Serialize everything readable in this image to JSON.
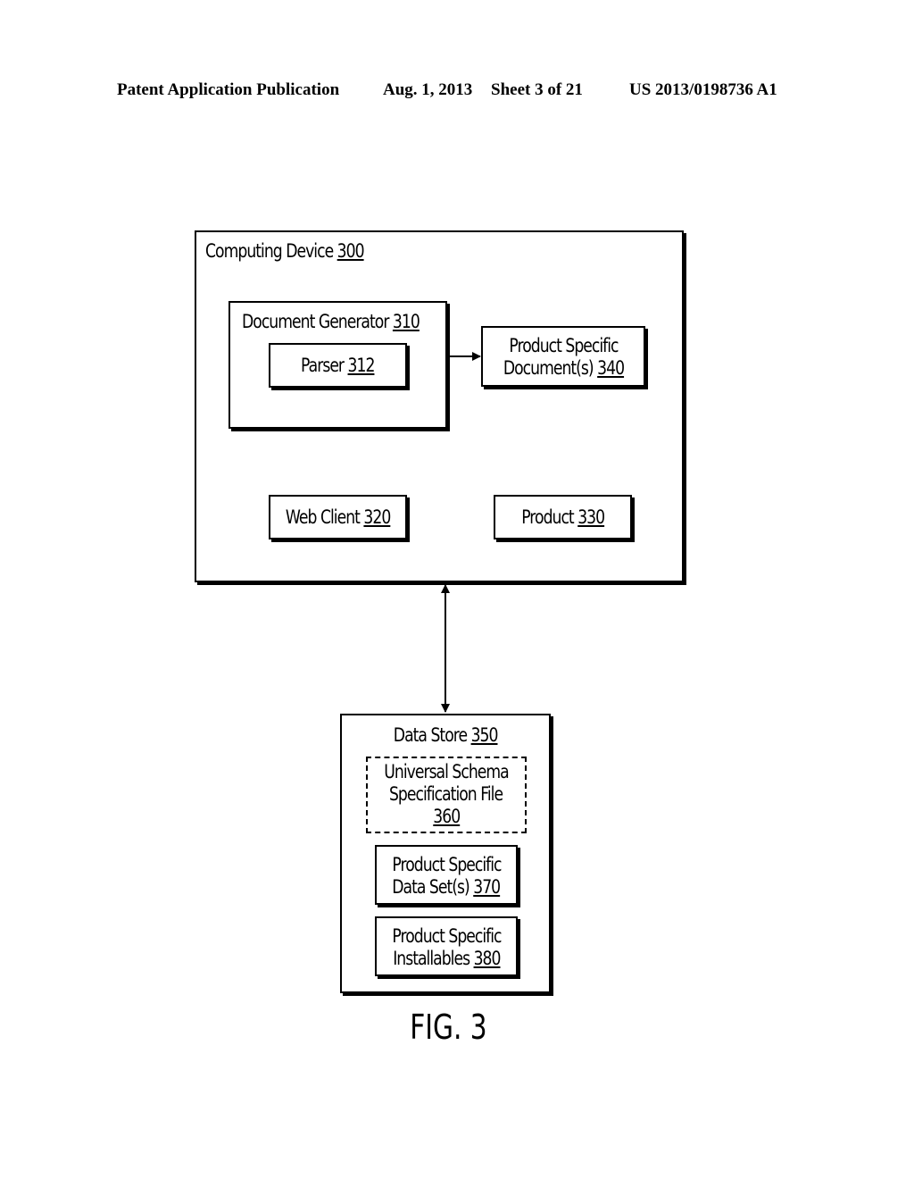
{
  "header": {
    "publication": "Patent Application Publication",
    "date": "Aug. 1, 2013",
    "sheet": "Sheet 3 of 21",
    "number": "US 2013/0198736 A1"
  },
  "diagram": {
    "computing_device": {
      "label": "Computing Device",
      "ref": "300"
    },
    "document_generator": {
      "label": "Document Generator",
      "ref": "310"
    },
    "parser": {
      "label": "Parser",
      "ref": "312"
    },
    "product_specific_documents": {
      "line1": "Product Specific",
      "line2": "Document(s)",
      "ref": "340"
    },
    "web_client": {
      "label": "Web Client",
      "ref": "320"
    },
    "product": {
      "label": "Product",
      "ref": "330"
    },
    "data_store": {
      "label": "Data Store",
      "ref": "350"
    },
    "universal_schema": {
      "line1": "Universal Schema",
      "line2": "Specification File",
      "ref": "360"
    },
    "product_specific_data_sets": {
      "line1": "Product Specific",
      "line2": "Data Set(s)",
      "ref": "370"
    },
    "product_specific_installables": {
      "line1": "Product Specific",
      "line2": "Installables",
      "ref": "380"
    },
    "connections": [
      {
        "from": "document_generator",
        "to": "product_specific_documents",
        "type": "one-way-arrow"
      },
      {
        "from": "computing_device",
        "to": "data_store",
        "type": "two-way-arrow"
      }
    ]
  },
  "figure_label": "FIG. 3"
}
